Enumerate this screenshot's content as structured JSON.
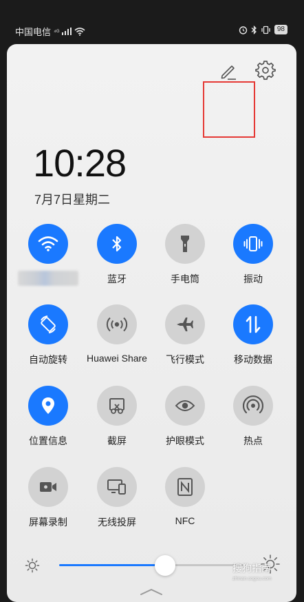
{
  "status_bar": {
    "carrier": "中国电信",
    "signal": "⁴ᴳ",
    "battery": "98"
  },
  "panel": {
    "time": "10:28",
    "date": "7月7日星期二"
  },
  "tiles": [
    {
      "label": "",
      "state": "on",
      "icon": "wifi-icon"
    },
    {
      "label": "蓝牙",
      "state": "on",
      "icon": "bluetooth-icon"
    },
    {
      "label": "手电筒",
      "state": "off",
      "icon": "flashlight-icon"
    },
    {
      "label": "振动",
      "state": "on",
      "icon": "vibrate-icon"
    },
    {
      "label": "自动旋转",
      "state": "on",
      "icon": "auto-rotate-icon"
    },
    {
      "label": "Huawei Share",
      "state": "off",
      "icon": "huawei-share-icon"
    },
    {
      "label": "飞行模式",
      "state": "off",
      "icon": "airplane-icon"
    },
    {
      "label": "移动数据",
      "state": "on",
      "icon": "mobile-data-icon"
    },
    {
      "label": "位置信息",
      "state": "on",
      "icon": "location-icon"
    },
    {
      "label": "截屏",
      "state": "off",
      "icon": "screenshot-icon"
    },
    {
      "label": "护眼模式",
      "state": "off",
      "icon": "eye-comfort-icon"
    },
    {
      "label": "热点",
      "state": "off",
      "icon": "hotspot-icon"
    },
    {
      "label": "屏幕录制",
      "state": "off",
      "icon": "screen-record-icon"
    },
    {
      "label": "无线投屏",
      "state": "off",
      "icon": "wireless-projection-icon"
    },
    {
      "label": "NFC",
      "state": "off",
      "icon": "nfc-icon"
    }
  ],
  "brightness": {
    "level": 0.57
  },
  "watermark": {
    "text": "搜狗指南",
    "sub": "zhinan.sogou.com"
  },
  "colors": {
    "accent": "#1a79ff",
    "tile_off": "#d2d2d2",
    "highlight": "#e53935"
  }
}
